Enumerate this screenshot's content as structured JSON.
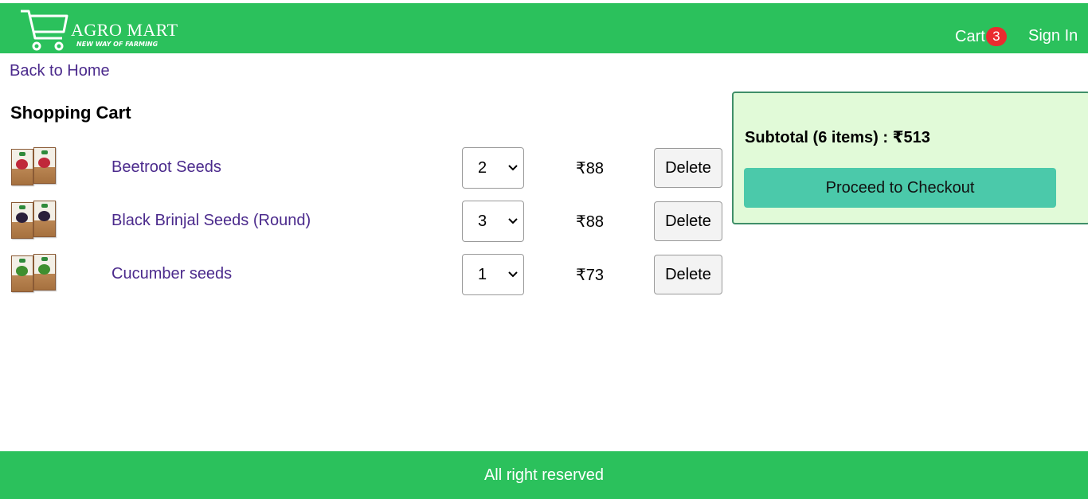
{
  "brand": {
    "name": "AGRO MART",
    "tagline": "NEW WAY OF FARMING"
  },
  "nav": {
    "cart_label": "Cart",
    "cart_count": "3",
    "signin_label": "Sign In"
  },
  "colors": {
    "header_green": "#2bc15c",
    "badge_red": "#ea2b2f",
    "link_purple": "#4b2a8c",
    "summary_bg": "#e1fad8",
    "checkout_teal": "#4bc9aa"
  },
  "back_link": "Back to Home",
  "page_title": "Shopping Cart",
  "cart_items": [
    {
      "name": "Beetroot Seeds",
      "quantity": "2",
      "price": "₹88",
      "delete_label": "Delete",
      "thumb_color": "#c0283a"
    },
    {
      "name": "Black Brinjal Seeds (Round)",
      "quantity": "3",
      "price": "₹88",
      "delete_label": "Delete",
      "thumb_color": "#2a1f3a"
    },
    {
      "name": "Cucumber seeds",
      "quantity": "1",
      "price": "₹73",
      "delete_label": "Delete",
      "thumb_color": "#3f8f2f"
    }
  ],
  "summary": {
    "subtotal": "Subtotal (6 items) : ₹513",
    "checkout_label": "Proceed to Checkout"
  },
  "footer": {
    "text": "All right reserved"
  }
}
